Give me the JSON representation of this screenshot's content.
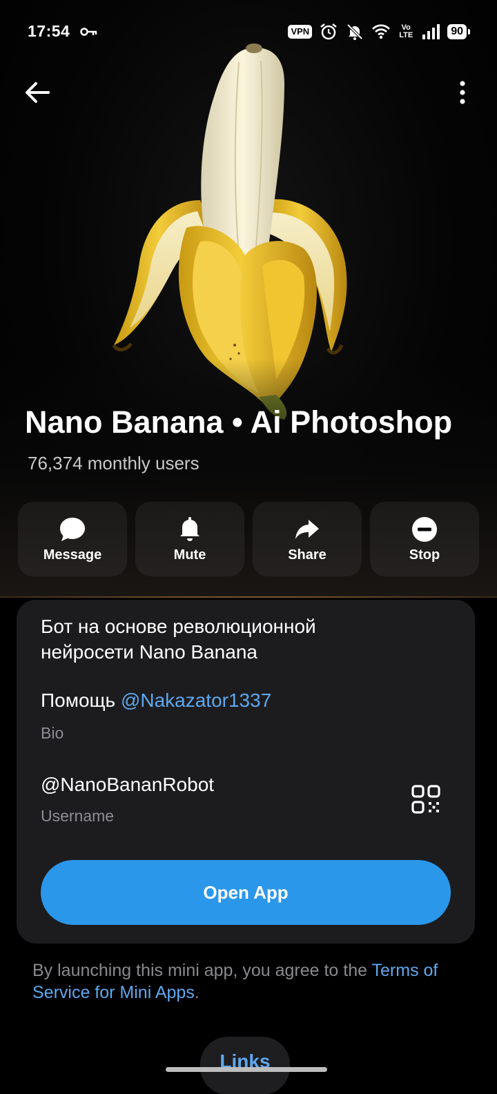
{
  "status_bar": {
    "time": "17:54",
    "vpn_label": "VPN",
    "volte_label_top": "Vo",
    "volte_label_bottom": "LTE",
    "battery": "90",
    "icons": [
      "key-icon",
      "alarm-icon",
      "bell-off-icon",
      "wifi-icon",
      "signal-icon"
    ]
  },
  "nav": {
    "back_icon": "arrow-left-icon",
    "more_icon": "more-vertical-icon"
  },
  "header": {
    "name": "Nano Banana • Ai Photoshop",
    "users": "76,374 monthly users",
    "avatar": "peeled-banana-photo"
  },
  "actions": [
    {
      "label": "Message",
      "icon": "chat-bubble-icon"
    },
    {
      "label": "Mute",
      "icon": "bell-icon"
    },
    {
      "label": "Share",
      "icon": "share-arrow-icon"
    },
    {
      "label": "Stop",
      "icon": "stop-circle-icon"
    }
  ],
  "info": {
    "bio_line1": "Бот на основе революционной",
    "bio_line2": "нейросети Nano Banana",
    "help_prefix": "Помощь ",
    "help_link": "@Nakazator1337",
    "bio_caption": "Bio",
    "username": "@NanoBananRobot",
    "username_caption": "Username",
    "open_app": "Open App"
  },
  "terms": {
    "text": "By launching this mini app, you agree to the ",
    "link": "Terms of Service for Mini Apps",
    "end": "."
  },
  "links_tab": "Links",
  "colors": {
    "accent": "#2b97ea",
    "link": "#5fa8f0",
    "card": "#1c1c1e",
    "background": "#000000"
  }
}
